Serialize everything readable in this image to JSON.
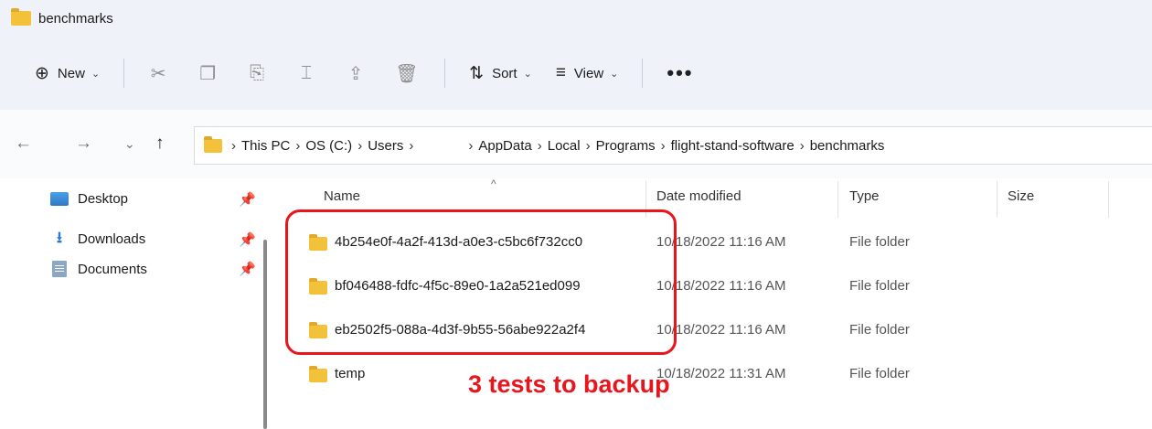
{
  "window": {
    "title": "benchmarks"
  },
  "toolbar": {
    "new_label": "New",
    "sort_label": "Sort",
    "view_label": "View",
    "more_label": "•••"
  },
  "address": {
    "crumbs": [
      "This PC",
      "OS (C:)",
      "Users",
      "AppData",
      "Local",
      "Programs",
      "flight-stand-software",
      "benchmarks"
    ]
  },
  "sidebar": {
    "items": [
      {
        "label": "Desktop"
      },
      {
        "label": "Downloads"
      },
      {
        "label": "Documents"
      }
    ]
  },
  "columns": [
    "Name",
    "Date modified",
    "Type",
    "Size"
  ],
  "files": [
    {
      "name": "4b254e0f-4a2f-413d-a0e3-c5bc6f732cc0",
      "date": "10/18/2022 11:16 AM",
      "type": "File folder"
    },
    {
      "name": "bf046488-fdfc-4f5c-89e0-1a2a521ed099",
      "date": "10/18/2022 11:16 AM",
      "type": "File folder"
    },
    {
      "name": "eb2502f5-088a-4d3f-9b55-56abe922a2f4",
      "date": "10/18/2022 11:16 AM",
      "type": "File folder"
    },
    {
      "name": "temp",
      "date": "10/18/2022 11:31 AM",
      "type": "File folder"
    }
  ],
  "annotation": {
    "text": "3 tests to backup",
    "color": "#e8161c"
  },
  "colors": {
    "folder": "#f3c23a",
    "accent": "#2b7bd6",
    "annotation": "#e8161c"
  }
}
